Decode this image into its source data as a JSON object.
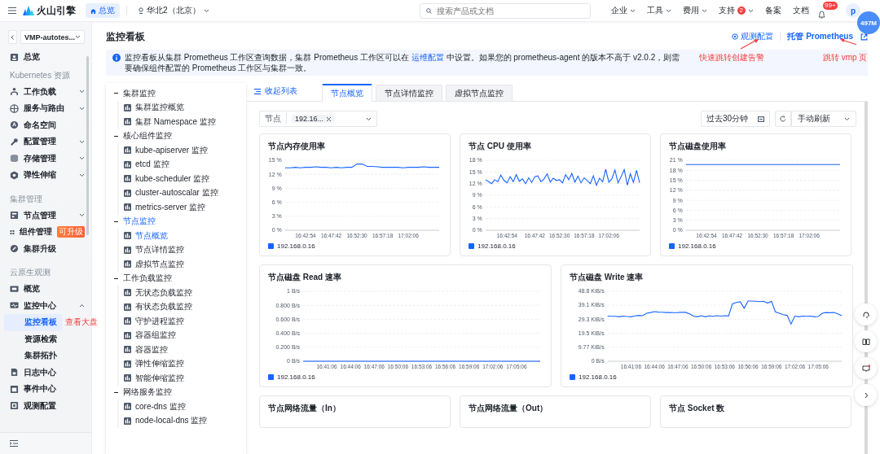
{
  "topbar": {
    "logo": "火山引擎",
    "home": "总览",
    "region": "华北2（北京）",
    "search": {
      "placeholder": "搜索产品或文档"
    },
    "nav": [
      {
        "label": "企业",
        "dropdown": true
      },
      {
        "label": "工具",
        "dropdown": true
      },
      {
        "label": "费用",
        "dropdown": true
      },
      {
        "label": "支持",
        "badge": "2",
        "dropdown": true
      },
      {
        "label": "备案",
        "dropdown": false
      },
      {
        "label": "文档",
        "dropdown": false
      }
    ],
    "notifications": "99+",
    "avatar": "p",
    "memory": "497M"
  },
  "sidebar": {
    "cluster": "VMP-autotes...",
    "items": [
      {
        "label": "总览",
        "selected": false
      }
    ],
    "sections": [
      {
        "title": "Kubernetes 资源",
        "items": [
          {
            "label": "工作负载",
            "expanded": false,
            "selected": false
          },
          {
            "label": "服务与路由",
            "expanded": false,
            "selected": false
          },
          {
            "label": "命名空间",
            "selected": false
          },
          {
            "label": "配置管理",
            "expanded": false,
            "selected": false
          },
          {
            "label": "存储管理",
            "expanded": false,
            "selected": false
          },
          {
            "label": "弹性伸缩",
            "expanded": false,
            "selected": false
          }
        ]
      },
      {
        "title": "集群管理",
        "items": [
          {
            "label": "节点管理",
            "expanded": false,
            "selected": false
          },
          {
            "label": "组件管理",
            "badge": "可升级",
            "selected": false
          },
          {
            "label": "集群升级",
            "selected": false
          }
        ]
      },
      {
        "title": "云原生观测",
        "items": [
          {
            "label": "概览",
            "selected": false
          },
          {
            "label": "监控中心",
            "expanded": true,
            "selected": false,
            "children": [
              {
                "label": "监控看板",
                "selected": true
              },
              {
                "label": "资源检索",
                "selected": false
              },
              {
                "label": "集群拓扑",
                "selected": false
              }
            ]
          },
          {
            "label": "日志中心",
            "selected": false
          },
          {
            "label": "事件中心",
            "selected": false
          },
          {
            "label": "观测配置",
            "selected": false
          }
        ]
      }
    ]
  },
  "page": {
    "title": "监控看板",
    "links": [
      "观测配置",
      "托管 Prometheus"
    ],
    "banner": {
      "before": "监控看板从集群 Prometheus 工作区查询数据，集群 Prometheus 工作区可以在 ",
      "link": "运维配置",
      "after": " 中设置。如果您的 prometheus-agent 的版本不高于 v2.0.2，则需要确保组件配置的 Prometheus 工作区与集群一致。"
    }
  },
  "annotations": [
    "快速跳转创建告警",
    "跳转 vmp 页",
    "查看大盘"
  ],
  "tree": [
    {
      "label": "集群监控",
      "expanded": true,
      "selected": false,
      "children": [
        {
          "label": "集群监控概览",
          "selected": false
        },
        {
          "label": "集群 Namespace 监控",
          "selected": false
        }
      ]
    },
    {
      "label": "核心组件监控",
      "expanded": true,
      "selected": false,
      "children": [
        {
          "label": "kube-apiserver 监控",
          "selected": false
        },
        {
          "label": "etcd 监控",
          "selected": false
        },
        {
          "label": "kube-scheduler 监控",
          "selected": false
        },
        {
          "label": "cluster-autoscalar 监控",
          "selected": false
        },
        {
          "label": "metrics-server 监控",
          "selected": false
        }
      ]
    },
    {
      "label": "节点监控",
      "expanded": true,
      "selected": true,
      "children": [
        {
          "label": "节点概览",
          "selected": true
        },
        {
          "label": "节点详情监控",
          "selected": false
        },
        {
          "label": "虚拟节点监控",
          "selected": false
        }
      ]
    },
    {
      "label": "工作负载监控",
      "expanded": true,
      "selected": false,
      "children": [
        {
          "label": "无状态负载监控",
          "selected": false
        },
        {
          "label": "有状态负载监控",
          "selected": false
        },
        {
          "label": "守护进程监控",
          "selected": false
        },
        {
          "label": "容器组监控",
          "selected": false
        },
        {
          "label": "容器监控",
          "selected": false
        },
        {
          "label": "弹性伸缩监控",
          "selected": false
        },
        {
          "label": "智能伸缩监控",
          "selected": false
        }
      ]
    },
    {
      "label": "网络服务监控",
      "expanded": true,
      "selected": false,
      "children": [
        {
          "label": "core-dns 监控",
          "selected": false
        },
        {
          "label": "node-local-dns 监控",
          "selected": false
        }
      ]
    }
  ],
  "collapse_link": "收起列表",
  "tabs": [
    {
      "label": "节点概览",
      "selected": true
    },
    {
      "label": "节点详情监控",
      "selected": false
    },
    {
      "label": "虚拟节点监控",
      "selected": false
    }
  ],
  "filters": {
    "node_label": "节点",
    "node_tag": "192.16...",
    "time_range": "过去30分钟",
    "refresh": "手动刷新"
  },
  "charts_row1": [
    {
      "chart_data": {
        "type": "line",
        "title": "节点内存使用率",
        "grid": true,
        "ylim": [
          0,
          15
        ],
        "yticks": [
          {
            "value": 0,
            "label": "0 %"
          },
          {
            "value": 3,
            "label": "3 %"
          },
          {
            "value": 6,
            "label": "6 %"
          },
          {
            "value": 9,
            "label": "9 %"
          },
          {
            "value": 12,
            "label": "12 %"
          },
          {
            "value": 15,
            "label": "15 %"
          }
        ],
        "categories": [
          null,
          null,
          null,
          null,
          "16:42:54",
          null,
          null,
          null,
          null,
          "16:47:42",
          null,
          null,
          null,
          null,
          "16:52:30",
          null,
          null,
          null,
          null,
          "16:57:18",
          null,
          null,
          null,
          null,
          "17:02:06",
          null,
          null,
          null,
          null,
          null,
          null
        ],
        "series": [
          {
            "name": "192.168.0.16",
            "color": "#1664ff",
            "values": [
              13.4,
              13.4,
              13.5,
              13.4,
              13.5,
              13.5,
              13.6,
              13.5,
              13.5,
              13.4,
              13.5,
              13.4,
              13.5,
              13.5,
              14.2,
              14.2,
              13.7,
              13.7,
              13.6,
              13.5,
              13.5,
              13.5,
              13.5,
              13.4,
              13.5,
              13.5,
              13.5,
              13.6,
              13.5,
              13.5,
              13.5
            ]
          }
        ]
      }
    },
    {
      "chart_data": {
        "type": "line",
        "title": "节点 CPU 使用率",
        "grid": true,
        "ylim": [
          0,
          18
        ],
        "yticks": [
          {
            "value": 0,
            "label": "0 %"
          },
          {
            "value": 3,
            "label": "3 %"
          },
          {
            "value": 6,
            "label": "6 %"
          },
          {
            "value": 9,
            "label": "9 %"
          },
          {
            "value": 12,
            "label": "12 %"
          },
          {
            "value": 15,
            "label": "15 %"
          },
          {
            "value": 18,
            "label": "18 %"
          }
        ],
        "categories": [
          null,
          null,
          null,
          null,
          null,
          null,
          null,
          "16:42:54",
          null,
          null,
          null,
          null,
          null,
          null,
          null,
          null,
          "16:47:42",
          null,
          null,
          null,
          null,
          null,
          null,
          null,
          "16:52:30",
          null,
          null,
          null,
          null,
          null,
          null,
          null,
          "16:57:18",
          null,
          null,
          null,
          null,
          null,
          null,
          null,
          "17:02:06",
          null,
          null,
          null,
          null,
          null,
          null,
          null,
          null,
          null,
          null
        ],
        "series": [
          {
            "name": "192.168.0.16",
            "color": "#1664ff",
            "values": [
              13,
              12.5,
              12,
              13,
              12.5,
              14.2,
              12.8,
              12.2,
              13.8,
              12.5,
              14.3,
              12.6,
              13.2,
              12,
              13.5,
              12.3,
              13.8,
              14,
              12.5,
              13.2,
              14.5,
              12.4,
              13.4,
              12.8,
              13,
              12.2,
              14.3,
              13,
              14.6,
              12.4,
              13.9,
              12.2,
              13.5,
              12.8,
              12,
              14,
              11.6,
              13.4,
              12.5,
              15.7,
              12.4,
              13.2,
              15.5,
              12.2,
              13.8,
              15.6,
              11.6,
              14.5,
              12.3,
              15.4,
              12.2
            ]
          }
        ]
      }
    },
    {
      "chart_data": {
        "type": "line",
        "title": "节点磁盘使用率",
        "grid": true,
        "ylim": [
          0,
          21
        ],
        "yticks": [
          {
            "value": 0,
            "label": "0 %"
          },
          {
            "value": 3,
            "label": "3 %"
          },
          {
            "value": 6,
            "label": "6 %"
          },
          {
            "value": 9,
            "label": "9 %"
          },
          {
            "value": 12,
            "label": "12 %"
          },
          {
            "value": 15,
            "label": "15 %"
          },
          {
            "value": 18,
            "label": "18 %"
          },
          {
            "value": 21,
            "label": "21 %"
          }
        ],
        "categories": [
          null,
          null,
          null,
          null,
          "16:42:54",
          null,
          null,
          null,
          null,
          "16:47:42",
          null,
          null,
          null,
          null,
          "16:52:30",
          null,
          null,
          null,
          null,
          "16:57:18",
          null,
          null,
          null,
          null,
          "17:02:06",
          null,
          null,
          null,
          null,
          null,
          null
        ],
        "series": [
          {
            "name": "192.168.0.16",
            "color": "#1664ff",
            "values": [
              19.7,
              19.7,
              19.7,
              19.7,
              19.7,
              19.7,
              19.7,
              19.7,
              19.7,
              19.7,
              19.7,
              19.7,
              19.7,
              19.7,
              19.7,
              19.7,
              19.7,
              19.7,
              19.7,
              19.7,
              19.7,
              19.7,
              19.7,
              19.7,
              19.7,
              19.7,
              19.7,
              19.7,
              19.7,
              19.7,
              19.7
            ]
          }
        ]
      }
    }
  ],
  "charts_row2": [
    {
      "chart_data": {
        "type": "line",
        "title": "节点磁盘 Read 速率",
        "grid": true,
        "ylim": [
          0,
          1
        ],
        "yticks": [
          {
            "value": 0,
            "label": "0  B/s"
          },
          {
            "value": 0.2,
            "label": "0.200  B/s"
          },
          {
            "value": 0.4,
            "label": "0.400  B/s"
          },
          {
            "value": 0.6,
            "label": "0.600  B/s"
          },
          {
            "value": 0.8,
            "label": "0.800  B/s"
          },
          {
            "value": 1,
            "label": "1  B/s"
          }
        ],
        "categories": [
          null,
          null,
          null,
          "16:41:06",
          null,
          null,
          "16:44:06",
          null,
          null,
          "16:47:06",
          null,
          null,
          "16:50:06",
          null,
          null,
          "16:53:06",
          null,
          null,
          "16:56:06",
          null,
          null,
          "16:59:06",
          null,
          null,
          "17:02:06",
          null,
          null,
          "17:05:06",
          null,
          null,
          null
        ],
        "series": [
          {
            "name": "192.168.0.16",
            "color": "#1664ff",
            "values": [
              0,
              0,
              0,
              0,
              0,
              0,
              0,
              0,
              0,
              0,
              0,
              0,
              0,
              0,
              0,
              0,
              0,
              0,
              0,
              0,
              0,
              0,
              0,
              0,
              0,
              0,
              0,
              0,
              0,
              0,
              0
            ]
          }
        ]
      }
    },
    {
      "chart_data": {
        "type": "line",
        "title": "节点磁盘 Write 速率",
        "grid": true,
        "ylim": [
          0,
          48.8
        ],
        "yticks": [
          {
            "value": 0,
            "label": "0  B/s"
          },
          {
            "value": 9.77,
            "label": "9.77  KiB/s"
          },
          {
            "value": 19.5,
            "label": "19.5  KiB/s"
          },
          {
            "value": 29.3,
            "label": "29.3  KiB/s"
          },
          {
            "value": 39.1,
            "label": "39.1  KiB/s"
          },
          {
            "value": 48.8,
            "label": "48.8  KiB/s"
          }
        ],
        "categories": [
          null,
          null,
          null,
          null,
          null,
          null,
          "16:41:06",
          null,
          null,
          null,
          null,
          null,
          "16:44:06",
          null,
          null,
          null,
          null,
          null,
          "16:47:06",
          null,
          null,
          null,
          null,
          null,
          "16:50:06",
          null,
          null,
          null,
          null,
          null,
          "16:53:06",
          null,
          null,
          null,
          null,
          null,
          "16:56:06",
          null,
          null,
          null,
          null,
          null,
          "16:59:06",
          null,
          null,
          null,
          null,
          null,
          "17:02:06",
          null,
          null,
          null,
          null,
          null,
          "17:05:06",
          null,
          null,
          null,
          null,
          null,
          null
        ],
        "series": [
          {
            "name": "192.168.0.16",
            "color": "#1664ff",
            "values": [
              31.5,
              31.3,
              31.4,
              31.0,
              31.5,
              31.2,
              31.0,
              31.6,
              32.0,
              31.8,
              33.5,
              34.0,
              34.6,
              34.3,
              34.2,
              34.0,
              34.0,
              33.9,
              34.0,
              34.2,
              34.1,
              33.0,
              31.5,
              31.0,
              31.8,
              31.0,
              31.6,
              31.3,
              31.8,
              31.5,
              31.8,
              31.6,
              40.0,
              41.0,
              41.5,
              37.0,
              42.0,
              42.0,
              41.8,
              41.6,
              41.8,
              40.5,
              41.8,
              34.5,
              33.5,
              32.5,
              32.0,
              26.0,
              31.5,
              31.0,
              31.5,
              31.3,
              31.5,
              31.0,
              31.2,
              33.5,
              34.0,
              33.8,
              34.0,
              33.0,
              31.8
            ]
          }
        ]
      }
    }
  ],
  "charts_row3": [
    {
      "title": "节点网络流量（In）"
    },
    {
      "title": "节点网络流量（Out）"
    },
    {
      "title": "节点 Socket 数"
    }
  ]
}
